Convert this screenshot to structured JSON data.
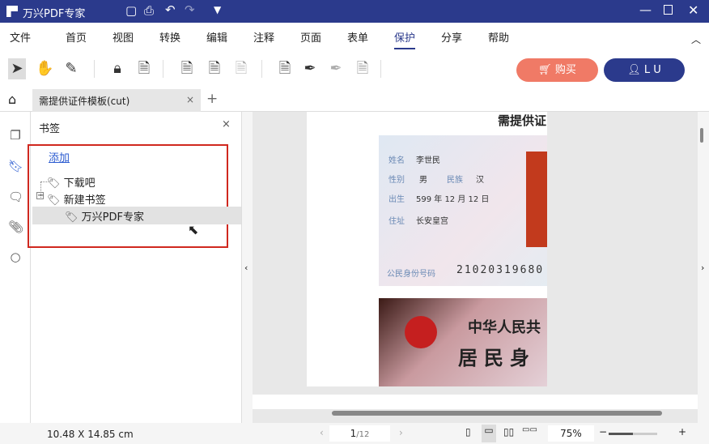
{
  "app": {
    "title": "万兴PDF专家"
  },
  "menu": [
    "文件",
    "首页",
    "视图",
    "转换",
    "编辑",
    "注释",
    "页面",
    "表单",
    "保护",
    "分享",
    "帮助"
  ],
  "menu_active": "保护",
  "buttons": {
    "buy": "购买",
    "user": "L U"
  },
  "tab": {
    "label": "需提供证件模板(cut)"
  },
  "bookmarks": {
    "title": "书签",
    "add": "添加",
    "items": [
      {
        "label": "下载吧",
        "level": 0
      },
      {
        "label": "新建书签",
        "level": 0
      },
      {
        "label": "万兴PDF专家",
        "level": 1
      }
    ]
  },
  "document": {
    "heading": "需提供证",
    "id_front": {
      "name_label": "姓名",
      "name": "李世民",
      "sex_label": "性别",
      "sex": "男",
      "ethnic_label": "民族",
      "ethnic": "汉",
      "birth_label": "出生",
      "birth": "599 年 12 月 12 日",
      "addr_label": "住址",
      "addr": "长安皇宫",
      "idno_label": "公民身份号码",
      "idno": "21020319680"
    },
    "id_back": {
      "line1": "中华人民共",
      "line2": "居民身"
    }
  },
  "status": {
    "page_size": "10.48 X 14.85 cm",
    "page_current": "1",
    "page_total": "/12",
    "zoom": "75%"
  },
  "colors": {
    "brand": "#2b3a8c",
    "buy": "#f07a66",
    "highlight": "#d0281f"
  }
}
